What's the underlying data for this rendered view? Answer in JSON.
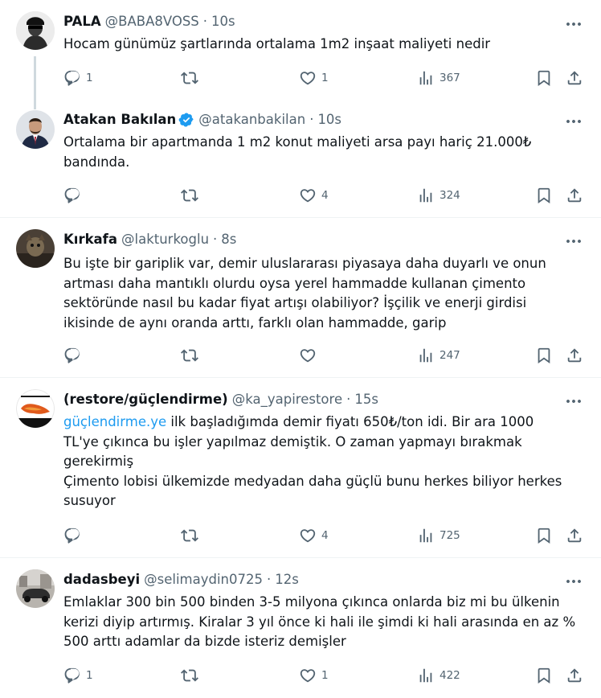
{
  "tweets": [
    {
      "name": "PALA",
      "handle": "@BABA8VOSS",
      "time": "10s",
      "verified": false,
      "lines": [
        "Hocam günümüz şartlarında ortalama 1m2 inşaat maliyeti nedir"
      ],
      "replies": "1",
      "retweets": "",
      "likes": "1",
      "views": "367"
    },
    {
      "name": "Atakan Bakılan",
      "handle": "@atakanbakilan",
      "time": "10s",
      "verified": true,
      "lines": [
        "Ortalama bir apartmanda 1 m2 konut maliyeti arsa payı hariç 21.000₺",
        "bandında."
      ],
      "replies": "",
      "retweets": "",
      "likes": "4",
      "views": "324"
    },
    {
      "name": "Kırkafa",
      "handle": "@lakturkoglu",
      "time": "8s",
      "verified": false,
      "lines": [
        "Bu işte bir gariplik var, demir uluslararası piyasaya daha duyarlı ve onun",
        "artması daha mantıklı olurdu oysa yerel hammadde kullanan çimento",
        "sektöründe nasıl bu kadar fiyat artışı olabiliyor? İşçilik ve enerji girdisi",
        "ikisinde de aynı oranda arttı, farklı olan hammadde, garip"
      ],
      "replies": "",
      "retweets": "",
      "likes": "",
      "views": "247"
    },
    {
      "name": "(restore/güçlendirme)",
      "handle": "@ka_yapirestore",
      "time": "15s",
      "verified": false,
      "link": "güçlendirme.ye",
      "line1_rest": " ilk başladığımda demir fiyatı 650₺/ton idi. Bir ara 1000",
      "lines": [
        "TL'ye çıkınca bu işler yapılmaz demiştik. O zaman yapmayı bırakmak",
        "gerekirmiş",
        "Çimento lobisi ülkemizde medyadan daha güçlü bunu herkes biliyor herkes",
        "susuyor"
      ],
      "replies": "",
      "retweets": "",
      "likes": "4",
      "views": "725"
    },
    {
      "name": "dadasbeyi",
      "handle": "@selimaydin0725",
      "time": "12s",
      "verified": false,
      "lines": [
        "Emlaklar 300 bin 500 binden 3-5 milyona çıkınca onlarda biz mi bu ülkenin",
        "kerizi diyip artırmış. Kiralar 3 yıl önce ki hali ile şimdi ki hali arasında en az %",
        "500 arttı adamlar da bizde isteriz demişler"
      ],
      "replies": "1",
      "retweets": "",
      "likes": "1",
      "views": "422"
    }
  ],
  "dot": "·",
  "icons": [
    "reply-icon",
    "retweet-icon",
    "like-icon",
    "views-icon",
    "bookmark-icon",
    "share-icon",
    "more-icon",
    "verified-badge-icon"
  ],
  "colors": {
    "text": "#0f1419",
    "muted": "#536471",
    "link": "#1d9bf0",
    "verified": "#1d9bf0",
    "divider": "#eff3f4"
  }
}
